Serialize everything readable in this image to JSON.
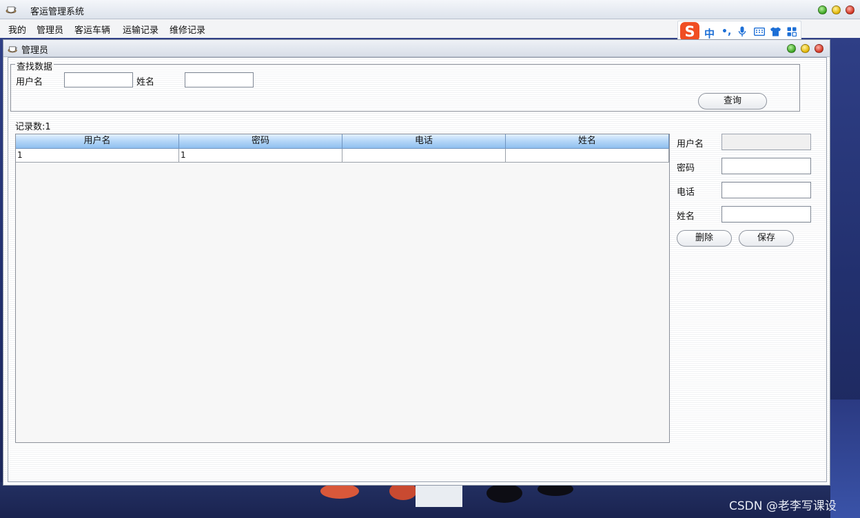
{
  "app": {
    "title": "客运管理系统"
  },
  "menu": {
    "items": [
      "我的",
      "管理员",
      "客运车辆",
      "运输记录",
      "维修记录"
    ]
  },
  "ime": {
    "mode": "中",
    "punct": "•,",
    "logo": "S"
  },
  "inner_window": {
    "title": "管理员"
  },
  "search": {
    "legend": "查找数据",
    "username_label": "用户名",
    "username_value": "",
    "name_label": "姓名",
    "name_value": "",
    "query_button": "查询"
  },
  "record_count": "记录数:1",
  "table": {
    "columns": [
      "用户名",
      "密码",
      "电话",
      "姓名"
    ],
    "rows": [
      [
        "1",
        "1",
        "",
        ""
      ]
    ]
  },
  "form": {
    "username_label": "用户名",
    "username_value": "",
    "password_label": "密码",
    "password_value": "",
    "phone_label": "电话",
    "phone_value": "",
    "name_label": "姓名",
    "name_value": "",
    "delete_button": "删除",
    "save_button": "保存"
  },
  "watermark": "CSDN @老李写课设"
}
